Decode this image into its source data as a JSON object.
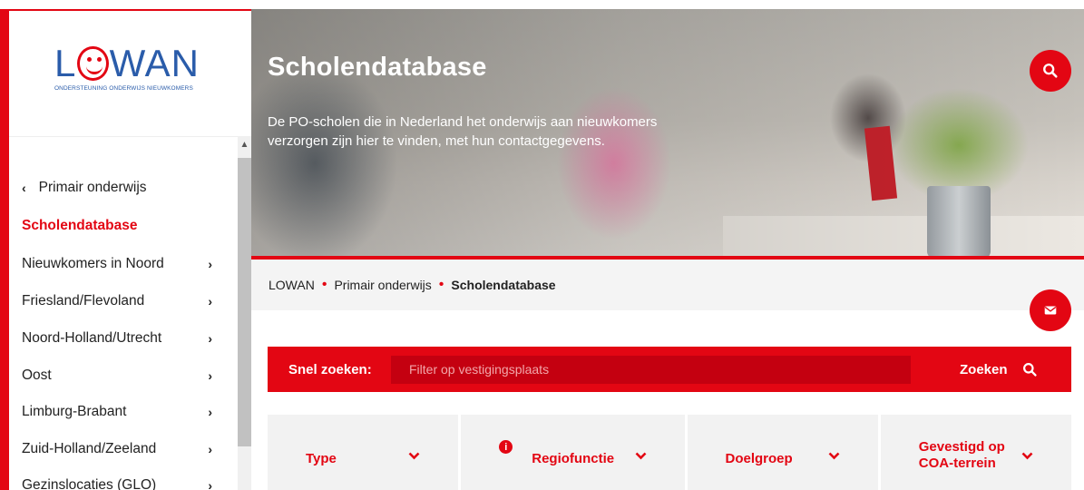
{
  "logo": {
    "word_left": "L",
    "word_right": "WAN",
    "tagline": "ONDERSTEUNING ONDERWIJS NIEUWKOMERS"
  },
  "sidebar": {
    "back_label": "Primair onderwijs",
    "current_label": "Scholendatabase",
    "items": [
      {
        "label": "Nieuwkomers in Noord"
      },
      {
        "label": "Friesland/Flevoland"
      },
      {
        "label": "Noord-Holland/Utrecht"
      },
      {
        "label": "Oost"
      },
      {
        "label": "Limburg-Brabant"
      },
      {
        "label": "Zuid-Holland/Zeeland"
      },
      {
        "label": "Gezinslocaties (GLO)"
      }
    ]
  },
  "hero": {
    "title": "Scholendatabase",
    "description": "De PO-scholen die in Nederland het onderwijs aan nieuwkomers verzorgen zijn hier te vinden, met hun contactgegevens."
  },
  "breadcrumb": {
    "home": "LOWAN",
    "parent": "Primair onderwijs",
    "current": "Scholendatabase"
  },
  "search": {
    "label": "Snel zoeken:",
    "placeholder": "Filter op vestigingsplaats",
    "button_label": "Zoeken"
  },
  "filters": [
    {
      "label": "Type"
    },
    {
      "label": "Regiofunctie"
    },
    {
      "label": "Doelgroep"
    },
    {
      "label": "Gevestigd op COA-terrein"
    }
  ],
  "colors": {
    "accent": "#e30613",
    "logo_blue": "#2a5caa"
  },
  "icons": [
    "search-icon",
    "mail-icon",
    "chevron-left-icon",
    "chevron-right-icon",
    "chevron-down-icon",
    "info-icon"
  ]
}
